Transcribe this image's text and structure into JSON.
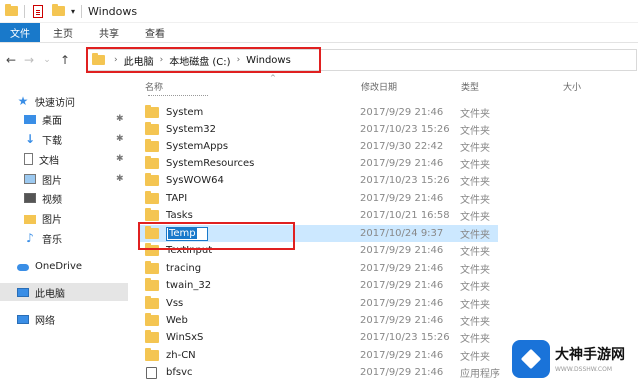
{
  "window": {
    "title": "Windows"
  },
  "ribbon": {
    "tabs": [
      "文件",
      "主页",
      "共享",
      "查看"
    ]
  },
  "address": {
    "breadcrumbs": [
      "此电脑",
      "本地磁盘 (C:)",
      "Windows"
    ]
  },
  "columns": {
    "name": "名称",
    "date": "修改日期",
    "type": "类型",
    "size": "大小"
  },
  "sidebar": {
    "items": [
      {
        "label": "快速访问",
        "icon": "star-icon"
      },
      {
        "label": "桌面",
        "icon": "desktop-icon",
        "pinned": true
      },
      {
        "label": "下载",
        "icon": "download-icon",
        "pinned": true
      },
      {
        "label": "文档",
        "icon": "document-icon",
        "pinned": true
      },
      {
        "label": "图片",
        "icon": "picture-icon",
        "pinned": true
      },
      {
        "label": "视频",
        "icon": "video-icon"
      },
      {
        "label": "图片",
        "icon": "folder-icon"
      },
      {
        "label": "音乐",
        "icon": "music-icon"
      },
      {
        "label": "OneDrive",
        "icon": "onedrive-icon"
      },
      {
        "label": "此电脑",
        "icon": "this-pc-icon",
        "selected": true
      },
      {
        "label": "网络",
        "icon": "network-icon"
      }
    ]
  },
  "files": [
    {
      "name": "System",
      "date": "2017/9/29 21:46",
      "type": "文件夹"
    },
    {
      "name": "System32",
      "date": "2017/10/23 15:26",
      "type": "文件夹"
    },
    {
      "name": "SystemApps",
      "date": "2017/9/30 22:42",
      "type": "文件夹"
    },
    {
      "name": "SystemResources",
      "date": "2017/9/29 21:46",
      "type": "文件夹"
    },
    {
      "name": "SysWOW64",
      "date": "2017/10/23 15:26",
      "type": "文件夹"
    },
    {
      "name": "TAPI",
      "date": "2017/9/29 21:46",
      "type": "文件夹"
    },
    {
      "name": "Tasks",
      "date": "2017/10/21 16:58",
      "type": "文件夹"
    },
    {
      "name": "Temp",
      "date": "2017/10/24 9:37",
      "type": "文件夹",
      "selected": true,
      "renaming": true
    },
    {
      "name": "TextInput",
      "date": "2017/9/29 21:46",
      "type": "文件夹"
    },
    {
      "name": "tracing",
      "date": "2017/9/29 21:46",
      "type": "文件夹"
    },
    {
      "name": "twain_32",
      "date": "2017/9/29 21:46",
      "type": "文件夹"
    },
    {
      "name": "Vss",
      "date": "2017/9/29 21:46",
      "type": "文件夹"
    },
    {
      "name": "Web",
      "date": "2017/9/29 21:46",
      "type": "文件夹"
    },
    {
      "name": "WinSxS",
      "date": "2017/10/23 15:26",
      "type": "文件夹"
    },
    {
      "name": "zh-CN",
      "date": "2017/9/29 21:46",
      "type": "文件夹"
    },
    {
      "name": "bfsvc",
      "date": "2017/9/29 21:46",
      "type": "应用程序",
      "file_icon": "app"
    }
  ],
  "watermark": {
    "title": "大神手游网",
    "url": "WWW.DSSHW.COM"
  },
  "colors": {
    "accent": "#1979ca",
    "selection": "#cce8ff",
    "highlight_box": "#e02020",
    "folder": "#f4c552"
  }
}
